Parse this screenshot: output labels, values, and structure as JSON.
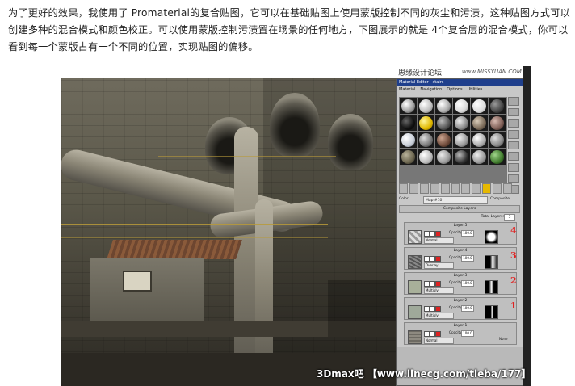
{
  "intro_text": "为了更好的效果，我使用了 Promaterial的复合贴图，它可以在基础贴图上使用蒙版控制不同的灰尘和污渍，这种贴图方式可以创建多种的混合模式和颜色校正。可以使用蒙版控制污渍置在场景的任何地方，下图展示的就是 4个复合层的混合模式，你可以看到每一个蒙版占有一个不同的位置，实现贴图的偏移。",
  "watermark_top": "思缘设计论坛",
  "watermark_top_url": "www.MISSYUAN.COM",
  "watermark_bottom": "3Dmax吧 【www.linecg.com/tieba/177】",
  "material_editor": {
    "title": "Material Editor - stairs",
    "menu": [
      "Material",
      "Navigation",
      "Options",
      "Utilities"
    ],
    "color_label": "Color",
    "map_name": "Map #10",
    "map_type": "Composite",
    "rollout_title": "Composite Layers",
    "total_layers_label": "Total Layers:",
    "total_layers_value": "5",
    "opacity_label": "Opacity:",
    "opacity_value": "100.0",
    "none_label": "None",
    "layers": [
      {
        "name": "Layer 5",
        "mode": "Normal",
        "marker": "4"
      },
      {
        "name": "Layer 4",
        "mode": "Overlay",
        "marker": "3"
      },
      {
        "name": "Layer 3",
        "mode": "Multiply",
        "marker": "2"
      },
      {
        "name": "Layer 2",
        "mode": "Multiply",
        "marker": "1"
      },
      {
        "name": "Layer 1",
        "mode": "Normal",
        "marker": ""
      }
    ]
  },
  "colors": {
    "title_bar": "#1f3f8c",
    "marker": "#e02020"
  }
}
